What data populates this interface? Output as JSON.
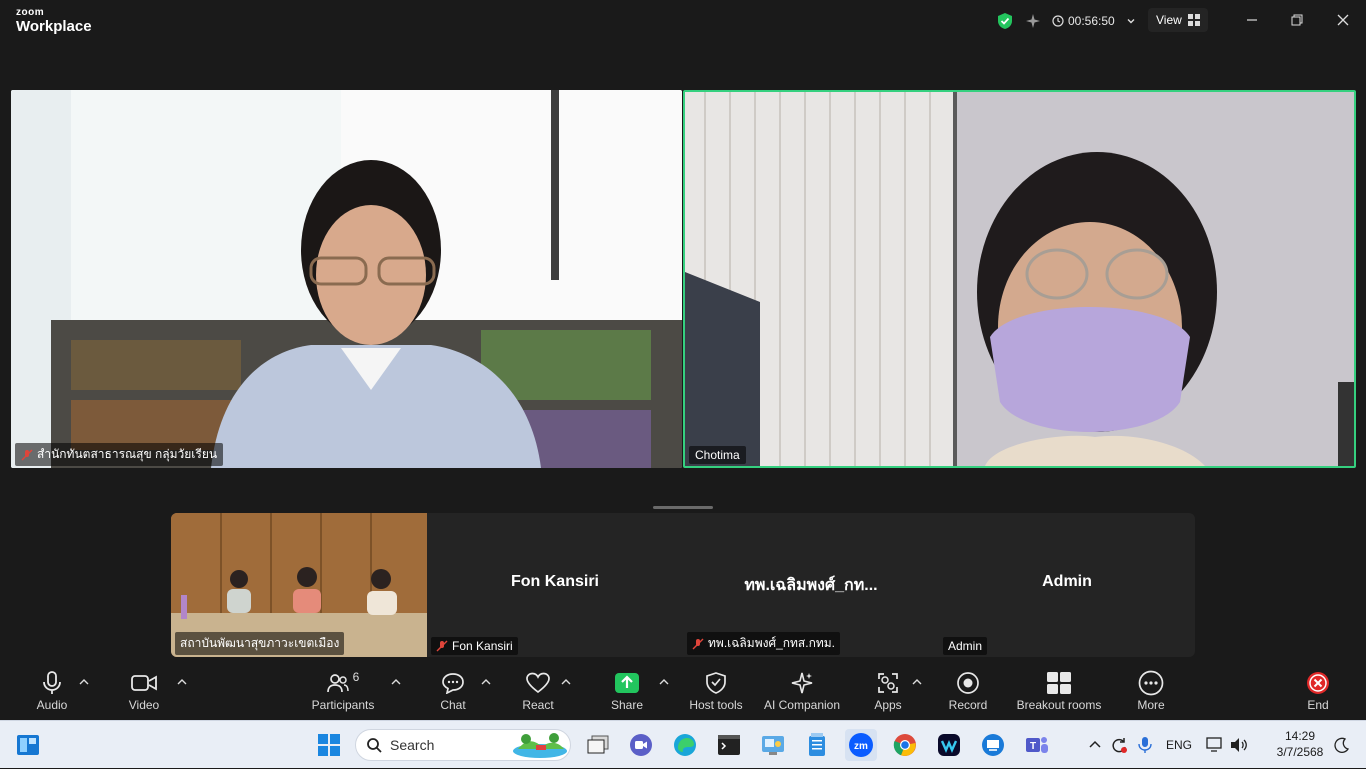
{
  "app": {
    "brand_small": "zoom",
    "brand_large": "Workplace"
  },
  "titlebar": {
    "timer": "00:56:50",
    "view_label": "View"
  },
  "gallery": {
    "tiles": [
      {
        "name": "สำนักทันตสาธารณสุข กลุ่มวัยเรียน",
        "muted": true
      },
      {
        "name": "Chotima",
        "muted": false,
        "active_speaker": true
      }
    ]
  },
  "filmstrip": [
    {
      "display": "",
      "tag": "สถาบันพัฒนาสุขภาวะเขตเมือง",
      "muted": false,
      "video": true
    },
    {
      "display": "Fon Kansiri",
      "tag": "Fon Kansiri",
      "muted": true,
      "video": false
    },
    {
      "display": "ทพ.เฉลิมพงศ์_กท...",
      "tag": "ทพ.เฉลิมพงศ์_กทส.กทม.",
      "muted": true,
      "video": false
    },
    {
      "display": "Admin",
      "tag": "Admin",
      "muted": false,
      "video": false
    }
  ],
  "toolbar": {
    "audio": "Audio",
    "video": "Video",
    "participants": "Participants",
    "participants_count": "6",
    "chat": "Chat",
    "react": "React",
    "share": "Share",
    "host_tools": "Host tools",
    "ai_companion": "AI Companion",
    "apps": "Apps",
    "record": "Record",
    "breakout": "Breakout rooms",
    "more": "More",
    "end": "End"
  },
  "taskbar": {
    "search_placeholder": "Search",
    "lang": "ENG",
    "time": "14:29",
    "date": "3/7/2568"
  },
  "colors": {
    "accent_green": "#35d07f",
    "share_green": "#22c55e",
    "end_red": "#e02828",
    "mute_red": "#e0453a"
  }
}
